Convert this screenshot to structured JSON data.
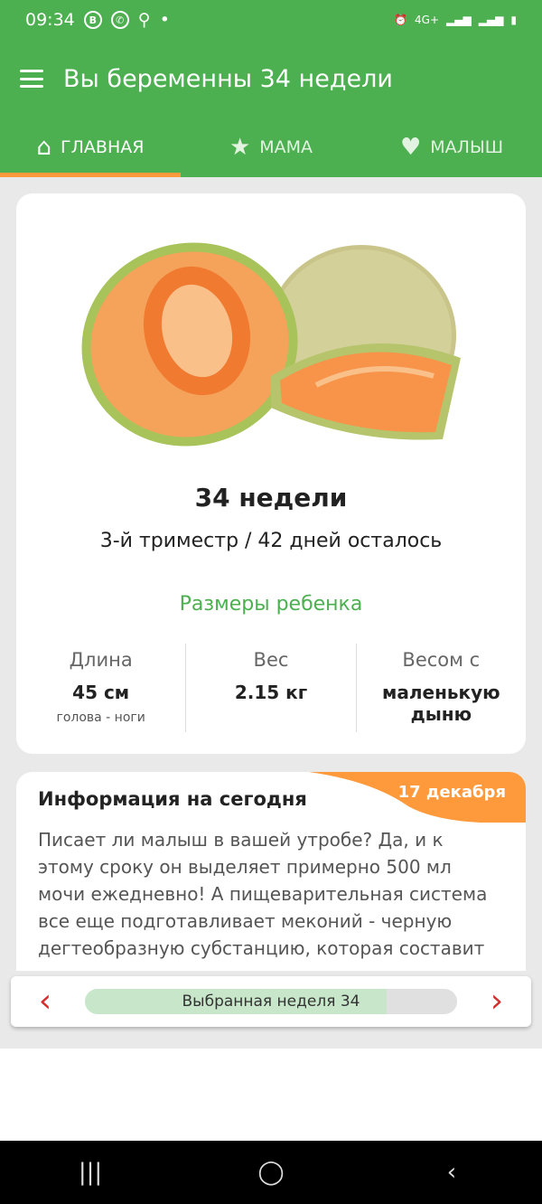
{
  "status": {
    "time": "09:34",
    "icons": [
      "b-icon",
      "viber-icon",
      "search-icon",
      "dot"
    ],
    "right": [
      "alarm-icon",
      "4G+",
      "signal",
      "signal",
      "battery"
    ]
  },
  "appbar": {
    "title": "Вы беременны 34 недели"
  },
  "tabs": [
    {
      "label": "ГЛАВНАЯ",
      "icon": "home-icon",
      "active": true
    },
    {
      "label": "МАМА",
      "icon": "star-icon",
      "active": false
    },
    {
      "label": "МАЛЫШ",
      "icon": "heart-icon",
      "active": false
    }
  ],
  "card": {
    "week": "34 недели",
    "trimester": "3-й триместр / 42 дней осталось",
    "sizes_title": "Размеры ребенка",
    "stats": [
      {
        "label": "Длина",
        "value": "45 см",
        "sub": "голова - ноги"
      },
      {
        "label": "Вес",
        "value": "2.15 кг",
        "sub": ""
      },
      {
        "label": "Весом с",
        "value": "маленькую дыню",
        "sub": ""
      }
    ]
  },
  "info": {
    "title": "Информация на сегодня",
    "date": "17 декабря",
    "text": "Писает ли малыш в вашей утробе? Да, и к этому сроку он выделяет примерно 500 мл мочи ежедневно! А пищеварительная система все еще подготавливает меконий - черную дегтеобразную субстанцию, которая составит"
  },
  "nav": {
    "label": "Выбранная неделя 34",
    "week": 34,
    "total_weeks": 42,
    "prev_icon": "chevron-left-icon",
    "next_icon": "chevron-right-icon"
  },
  "colors": {
    "primary": "#4caf50",
    "accent": "#ff9a3c",
    "arrow": "#d32f2f"
  }
}
